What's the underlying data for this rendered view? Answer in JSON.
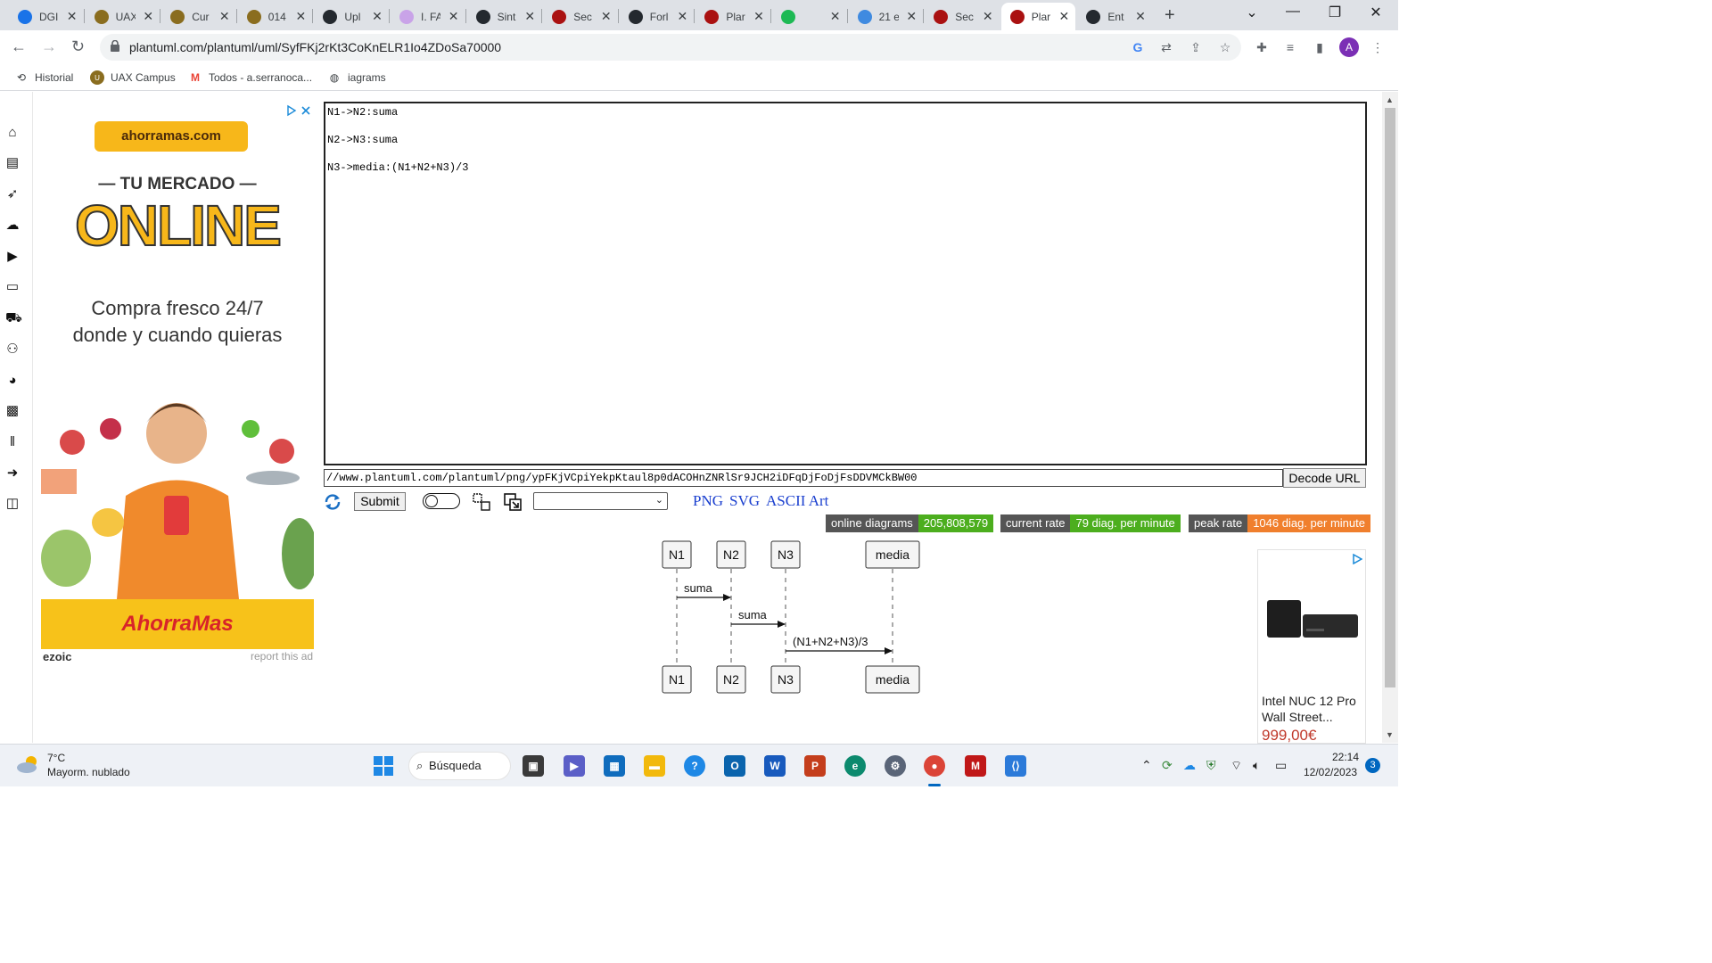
{
  "browser": {
    "tabs": [
      {
        "title": "DGI",
        "color": "#1a73e8"
      },
      {
        "title": "UAX",
        "color": "#8a6d1f"
      },
      {
        "title": "Cur",
        "color": "#8a6d1f"
      },
      {
        "title": "014",
        "color": "#8a6d1f"
      },
      {
        "title": "Upl",
        "color": "#24292f"
      },
      {
        "title": "I. FA",
        "color": "#c9a3e8"
      },
      {
        "title": "Sint",
        "color": "#24292f"
      },
      {
        "title": "Sec",
        "color": "#a11"
      },
      {
        "title": "Forl",
        "color": "#24292f"
      },
      {
        "title": "Plar",
        "color": "#a11"
      },
      {
        "title": "",
        "color": "#1db954"
      },
      {
        "title": "21 e",
        "color": "#3f8ae0"
      },
      {
        "title": "Sec",
        "color": "#a11"
      },
      {
        "title": "Plar",
        "color": "#a11",
        "active": true
      },
      {
        "title": "Ent",
        "color": "#24292f"
      }
    ],
    "url": "plantuml.com/plantuml/uml/SyfFKj2rKt3CoKnELR1Io4ZDoSa70000",
    "profile_initial": "A",
    "bookmarks": [
      {
        "label": "Historial",
        "icon": "history-icon"
      },
      {
        "label": "UAX Campus",
        "icon": "uax-icon"
      },
      {
        "label": "Todos - a.serranoca...",
        "icon": "gmail-icon"
      },
      {
        "label": "iagrams",
        "icon": "globe-icon"
      }
    ]
  },
  "ad": {
    "brand_domain": "ahorramas.com",
    "tagline": "— TU MERCADO —",
    "headline": "ONLINE",
    "body_line1": "Compra fresco 24/7",
    "body_line2": "donde y cuando quieras",
    "footer_brand": "AhorraMas",
    "network": "ezoic",
    "report": "report this ad"
  },
  "editor": {
    "lines": [
      "N1->N2:suma",
      "N2->N3:suma",
      "N3->media:(N1+N2+N3)/3"
    ]
  },
  "url_field": {
    "value": "//www.plantuml.com/plantuml/png/ypFKjVCpiYekpKtaul8p0dACOHnZNRlSr9JCH2iDFqDjFoDjFsDDVMCkBW00"
  },
  "controls": {
    "decode_label": "Decode URL",
    "submit_label": "Submit",
    "format_links": [
      "PNG",
      "SVG",
      "ASCII Art"
    ]
  },
  "stats": [
    {
      "key": "online diagrams",
      "value": "205,808,579",
      "color": "#4cae1e"
    },
    {
      "key": "current rate",
      "value": "79 diag. per minute",
      "color": "#4cae1e"
    },
    {
      "key": "peak rate",
      "value": "1046 diag. per minute",
      "color": "#f07f2d"
    }
  ],
  "diagram": {
    "participants": [
      "N1",
      "N2",
      "N3",
      "media"
    ],
    "messages": [
      {
        "from": 0,
        "to": 1,
        "label": "suma"
      },
      {
        "from": 1,
        "to": 2,
        "label": "suma"
      },
      {
        "from": 2,
        "to": 3,
        "label": "(N1+N2+N3)/3"
      }
    ]
  },
  "right_ad": {
    "product": "Intel NUC 12 Pro Wall Street...",
    "price": "999,00€"
  },
  "taskbar": {
    "temperature": "7°C",
    "condition": "Mayorm. nublado",
    "search_label": "Búsqueda",
    "time": "22:14",
    "date": "12/02/2023",
    "notifications": "3"
  }
}
